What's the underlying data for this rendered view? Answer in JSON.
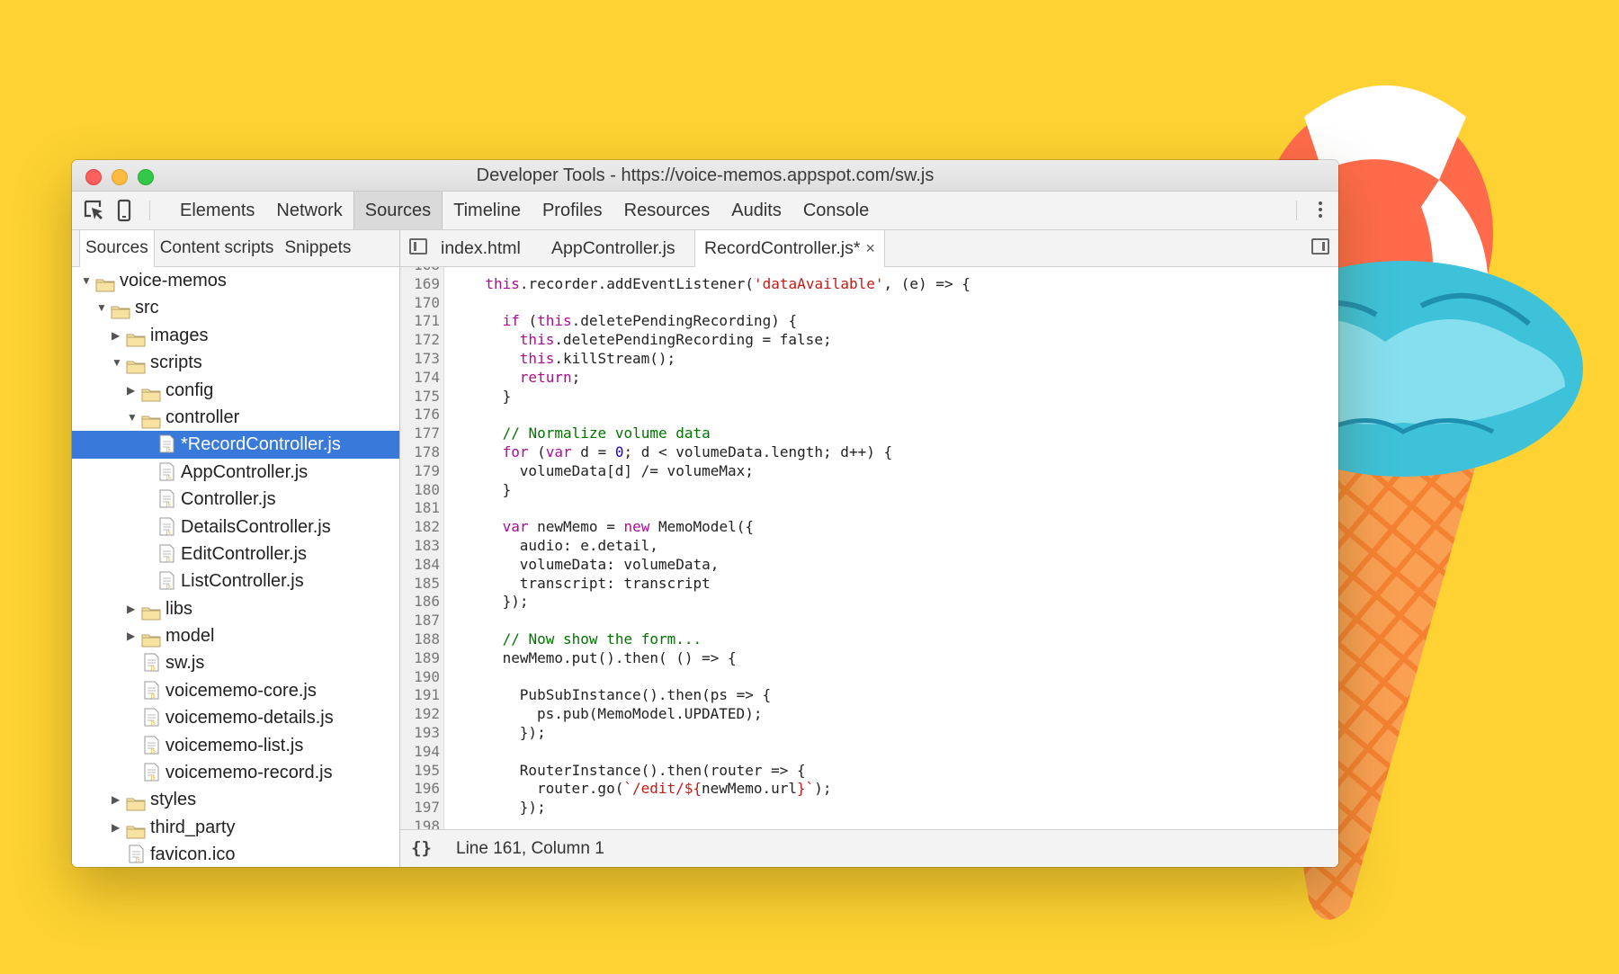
{
  "window": {
    "title": "Developer Tools - https://voice-memos.appspot.com/sw.js"
  },
  "toolbar": {
    "inspect_icon": "inspect-element-icon",
    "device_icon": "device-mode-icon",
    "tabs": [
      "Elements",
      "Network",
      "Sources",
      "Timeline",
      "Profiles",
      "Resources",
      "Audits",
      "Console"
    ],
    "active_tab": "Sources",
    "menu_icon": "more-vertical-icon"
  },
  "sidebar": {
    "tabs": [
      "Sources",
      "Content scripts",
      "Snippets"
    ],
    "active_tab": "Sources",
    "tree": [
      {
        "label": "voice-memos",
        "type": "folder",
        "depth": 0,
        "expanded": true
      },
      {
        "label": "src",
        "type": "folder",
        "depth": 1,
        "expanded": true
      },
      {
        "label": "images",
        "type": "folder",
        "depth": 2,
        "expanded": false
      },
      {
        "label": "scripts",
        "type": "folder",
        "depth": 2,
        "expanded": true
      },
      {
        "label": "config",
        "type": "folder",
        "depth": 3,
        "expanded": false
      },
      {
        "label": "controller",
        "type": "folder",
        "depth": 3,
        "expanded": true
      },
      {
        "label": "*RecordController.js",
        "type": "file",
        "depth": 4,
        "selected": true
      },
      {
        "label": "AppController.js",
        "type": "file",
        "depth": 4
      },
      {
        "label": "Controller.js",
        "type": "file",
        "depth": 4
      },
      {
        "label": "DetailsController.js",
        "type": "file",
        "depth": 4
      },
      {
        "label": "EditController.js",
        "type": "file",
        "depth": 4
      },
      {
        "label": "ListController.js",
        "type": "file",
        "depth": 4
      },
      {
        "label": "libs",
        "type": "folder",
        "depth": 3,
        "expanded": false
      },
      {
        "label": "model",
        "type": "folder",
        "depth": 3,
        "expanded": false
      },
      {
        "label": "sw.js",
        "type": "file",
        "depth": 3
      },
      {
        "label": "voicememo-core.js",
        "type": "file",
        "depth": 3
      },
      {
        "label": "voicememo-details.js",
        "type": "file",
        "depth": 3
      },
      {
        "label": "voicememo-list.js",
        "type": "file",
        "depth": 3
      },
      {
        "label": "voicememo-record.js",
        "type": "file",
        "depth": 3
      },
      {
        "label": "styles",
        "type": "folder",
        "depth": 2,
        "expanded": false
      },
      {
        "label": "third_party",
        "type": "folder",
        "depth": 2,
        "expanded": false
      },
      {
        "label": "favicon.ico",
        "type": "file",
        "depth": 2
      }
    ]
  },
  "editor": {
    "tabs": [
      {
        "label": "index.html",
        "active": false
      },
      {
        "label": "AppController.js",
        "active": false
      },
      {
        "label": "RecordController.js*",
        "active": true,
        "close_icon": "×"
      }
    ],
    "toggle_sidebar_icon": "toggle-navigator-icon",
    "toggle_debugger_icon": "toggle-debugger-icon",
    "first_partial_line": "168",
    "last_partial_line": "198",
    "lines": [
      {
        "n": "169",
        "indent": 2,
        "tokens": [
          [
            "this",
            "kw"
          ],
          [
            ".recorder.addEventListener(",
            ""
          ],
          [
            "'dataAvailable'",
            "str"
          ],
          [
            ", (e) => {",
            ""
          ]
        ]
      },
      {
        "n": "170",
        "indent": 0,
        "tokens": []
      },
      {
        "n": "171",
        "indent": 3,
        "tokens": [
          [
            "if",
            "kw"
          ],
          [
            " (",
            ""
          ],
          [
            "this",
            "kw"
          ],
          [
            ".deletePendingRecording) {",
            ""
          ]
        ]
      },
      {
        "n": "172",
        "indent": 4,
        "tokens": [
          [
            "this",
            "kw"
          ],
          [
            ".deletePendingRecording = false;",
            ""
          ]
        ]
      },
      {
        "n": "173",
        "indent": 4,
        "tokens": [
          [
            "this",
            "kw"
          ],
          [
            ".killStream();",
            ""
          ]
        ]
      },
      {
        "n": "174",
        "indent": 4,
        "tokens": [
          [
            "return",
            "kw"
          ],
          [
            ";",
            ""
          ]
        ]
      },
      {
        "n": "175",
        "indent": 3,
        "tokens": [
          [
            "}",
            ""
          ]
        ]
      },
      {
        "n": "176",
        "indent": 0,
        "tokens": []
      },
      {
        "n": "177",
        "indent": 3,
        "tokens": [
          [
            "// Normalize volume data",
            "cmt"
          ]
        ]
      },
      {
        "n": "178",
        "indent": 3,
        "tokens": [
          [
            "for",
            "kw"
          ],
          [
            " (",
            ""
          ],
          [
            "var",
            "kw"
          ],
          [
            " d = ",
            ""
          ],
          [
            "0",
            "num"
          ],
          [
            "; d < volumeData.length; d++) {",
            ""
          ]
        ]
      },
      {
        "n": "179",
        "indent": 4,
        "tokens": [
          [
            "volumeData[d] /= volumeMax;",
            ""
          ]
        ]
      },
      {
        "n": "180",
        "indent": 3,
        "tokens": [
          [
            "}",
            ""
          ]
        ]
      },
      {
        "n": "181",
        "indent": 0,
        "tokens": []
      },
      {
        "n": "182",
        "indent": 3,
        "tokens": [
          [
            "var",
            "kw"
          ],
          [
            " newMemo = ",
            ""
          ],
          [
            "new",
            "kw"
          ],
          [
            " MemoModel({",
            ""
          ]
        ]
      },
      {
        "n": "183",
        "indent": 4,
        "tokens": [
          [
            "audio: e.detail,",
            ""
          ]
        ]
      },
      {
        "n": "184",
        "indent": 4,
        "tokens": [
          [
            "volumeData: volumeData,",
            ""
          ]
        ]
      },
      {
        "n": "185",
        "indent": 4,
        "tokens": [
          [
            "transcript: transcript",
            ""
          ]
        ]
      },
      {
        "n": "186",
        "indent": 3,
        "tokens": [
          [
            "});",
            ""
          ]
        ]
      },
      {
        "n": "187",
        "indent": 0,
        "tokens": []
      },
      {
        "n": "188",
        "indent": 3,
        "tokens": [
          [
            "// Now show the form...",
            "cmt"
          ]
        ]
      },
      {
        "n": "189",
        "indent": 3,
        "tokens": [
          [
            "newMemo.put().then( () => {",
            ""
          ]
        ]
      },
      {
        "n": "190",
        "indent": 0,
        "tokens": []
      },
      {
        "n": "191",
        "indent": 4,
        "tokens": [
          [
            "PubSubInstance().then(ps => {",
            ""
          ]
        ]
      },
      {
        "n": "192",
        "indent": 5,
        "tokens": [
          [
            "ps.pub(MemoModel.UPDATED);",
            ""
          ]
        ]
      },
      {
        "n": "193",
        "indent": 4,
        "tokens": [
          [
            "});",
            ""
          ]
        ]
      },
      {
        "n": "194",
        "indent": 0,
        "tokens": []
      },
      {
        "n": "195",
        "indent": 4,
        "tokens": [
          [
            "RouterInstance().then(router => {",
            ""
          ]
        ]
      },
      {
        "n": "196",
        "indent": 5,
        "tokens": [
          [
            "router.go(",
            ""
          ],
          [
            "`/edit/${",
            "str"
          ],
          [
            "newMemo.url",
            ""
          ],
          [
            "}`",
            "str"
          ],
          [
            ");",
            ""
          ]
        ]
      },
      {
        "n": "197",
        "indent": 4,
        "tokens": [
          [
            "});",
            ""
          ]
        ]
      }
    ]
  },
  "statusbar": {
    "format_icon": "{}",
    "position": "Line 161, Column 1"
  },
  "colors": {
    "background": "#FDD232",
    "selection": "#3879d9",
    "keyword": "#aa0d91",
    "string": "#c41a16",
    "number": "#1c00cf",
    "comment": "#007400"
  }
}
